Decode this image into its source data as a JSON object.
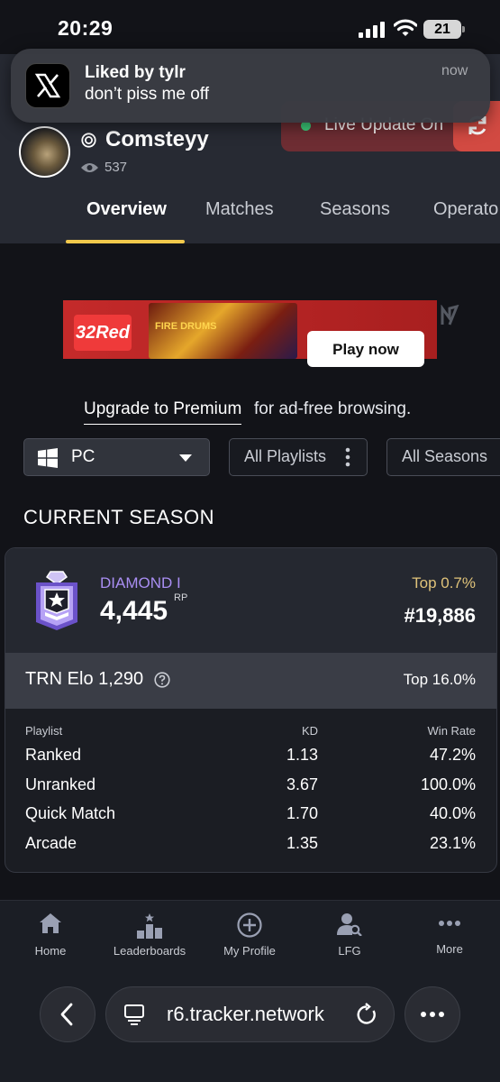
{
  "status_bar": {
    "time": "20:29",
    "battery": "21"
  },
  "notification": {
    "title": "Liked by tylr",
    "body": "don’t piss me off",
    "time": "now",
    "app_icon": "x-logo-icon"
  },
  "profile": {
    "username": "Comsteyy",
    "views": "537",
    "live_update_label": "Live Update On"
  },
  "tabs": [
    "Overview",
    "Matches",
    "Seasons",
    "Operato"
  ],
  "ad": {
    "brand": "32Red",
    "game": "FIRE DRUMS",
    "cta": "Play now"
  },
  "premium": {
    "link": "Upgrade to Premium",
    "rest": "for ad-free browsing."
  },
  "filters": {
    "platform": "PC",
    "playlist": "All Playlists",
    "season": "All Seasons"
  },
  "section_title": "CURRENT SEASON",
  "rank": {
    "name": "DIAMOND I",
    "rp": "4,445",
    "rp_label": "RP",
    "top": "Top 0.7%",
    "position": "#19,886",
    "elo_label": "TRN Elo 1,290",
    "elo_top": "Top 16.0%",
    "color": "#a98ef2"
  },
  "table": {
    "headers": {
      "playlist": "Playlist",
      "kd": "KD",
      "winrate": "Win Rate"
    },
    "rows": [
      {
        "playlist": "Ranked",
        "kd": "1.13",
        "winrate": "47.2%"
      },
      {
        "playlist": "Unranked",
        "kd": "3.67",
        "winrate": "100.0%"
      },
      {
        "playlist": "Quick Match",
        "kd": "1.70",
        "winrate": "40.0%"
      },
      {
        "playlist": "Arcade",
        "kd": "1.35",
        "winrate": "23.1%"
      }
    ]
  },
  "bottom_nav": [
    {
      "label": "Home",
      "icon": "home-icon"
    },
    {
      "label": "Leaderboards",
      "icon": "leaderboards-icon"
    },
    {
      "label": "My Profile",
      "icon": "add-circle-icon"
    },
    {
      "label": "LFG",
      "icon": "user-search-icon"
    },
    {
      "label": "More",
      "icon": "more-dots-icon"
    }
  ],
  "browser": {
    "url": "r6.tracker.network"
  }
}
